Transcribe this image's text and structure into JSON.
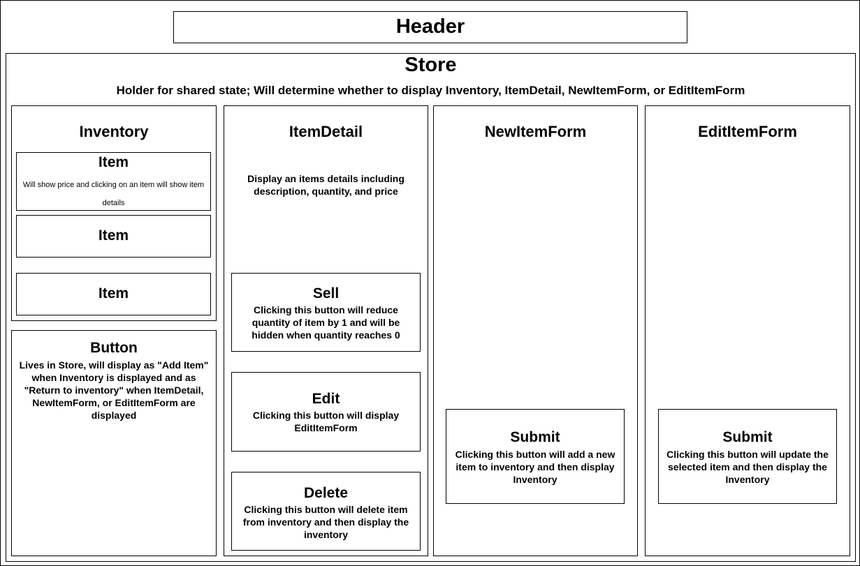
{
  "header": {
    "title": "Header"
  },
  "store": {
    "title": "Store",
    "description": "Holder for shared state; Will determine whether to display Inventory, ItemDetail, NewItemForm, or EditItemForm"
  },
  "inventory": {
    "title": "Inventory",
    "items": [
      {
        "title": "Item",
        "description": "Will show price and clicking on an item will show item details"
      },
      {
        "title": "Item"
      },
      {
        "title": "Item"
      }
    ]
  },
  "button": {
    "title": "Button",
    "description": "Lives in Store, will display as \"Add Item\" when Inventory is displayed and as \"Return to inventory\" when ItemDetail, NewItemForm, or EditItemForm are displayed"
  },
  "item_detail": {
    "title": "ItemDetail",
    "description": "Display an items details including description, quantity, and price",
    "sell": {
      "title": "Sell",
      "description": "Clicking this button will reduce quantity of item by 1 and will be hidden when quantity reaches 0"
    },
    "edit": {
      "title": "Edit",
      "description": "Clicking this button will display EditItemForm"
    },
    "delete": {
      "title": "Delete",
      "description": "Clicking this button will delete item from inventory and then display the inventory"
    }
  },
  "new_item_form": {
    "title": "NewItemForm",
    "submit": {
      "title": "Submit",
      "description": "Clicking this button will add a new item to inventory and then display Inventory"
    }
  },
  "edit_item_form": {
    "title": "EditItemForm",
    "submit": {
      "title": "Submit",
      "description": "Clicking this button will update the selected item and then display the Inventory"
    }
  }
}
